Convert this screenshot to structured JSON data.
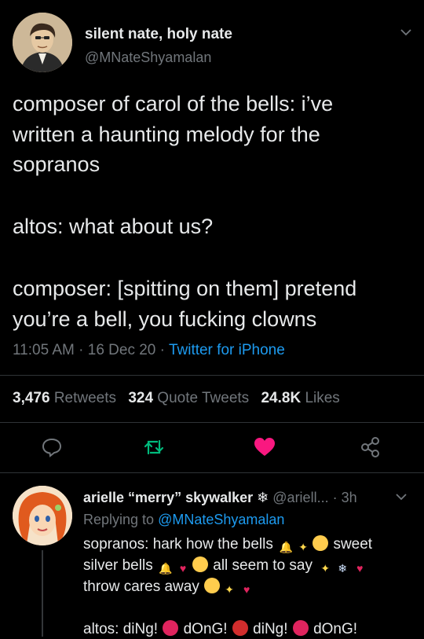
{
  "tweet": {
    "display_name": "silent nate, holy nate",
    "handle": "@MNateShyamalan",
    "text_lines": [
      "composer of carol of the bells: i’ve",
      "written a haunting melody for the",
      "sopranos",
      "altos: what about us?",
      "composer: [spitting on them] pretend",
      "you’re a bell, you fucking clowns"
    ],
    "time": "11:05 AM",
    "sep": "·",
    "date": "16 Dec 20",
    "source": "Twitter for iPhone",
    "stats": {
      "retweets_count": "3,476",
      "retweets_label": "Retweets",
      "quotes_count": "324",
      "quotes_label": "Quote Tweets",
      "likes_count": "24.8K",
      "likes_label": "Likes"
    },
    "icons": [
      "chevron-down-icon",
      "reply-icon",
      "retweet-icon",
      "like-icon",
      "share-icon"
    ],
    "colors": {
      "like": "#f91880",
      "retweet": "#00ba7c",
      "link": "#1d9bf0"
    }
  },
  "reply": {
    "display_name": "arielle “merry” skywalker",
    "snowflake": "❄",
    "handle_time": "@ariell... · 3h",
    "replying_prefix": "Replying to",
    "replying_to": "@MNateShyamalan",
    "line1": "sopranos: hark how the bells",
    "line1_end": "sweet",
    "line2": "silver bells",
    "line2_mid": "all seem to say",
    "line3": "throw cares away",
    "line4_a": "altos: diNg!",
    "line4_b": "dOnG!",
    "line4_c": "diNg!",
    "line4_d": "dOnG!"
  }
}
